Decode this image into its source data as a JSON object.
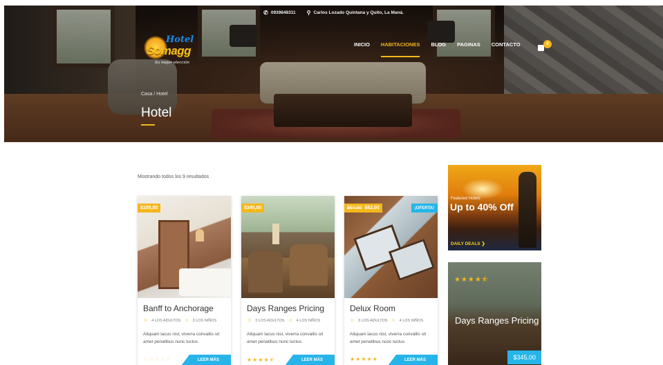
{
  "topbar": {
    "phone": "0939848311",
    "address": "Carlos Lozado Quintana y Quito, La Maná."
  },
  "logo": {
    "hotel": "Hotel",
    "brand": "Somagg",
    "tagline": "Su mejor elección"
  },
  "nav": {
    "items": [
      "INICIO",
      "HABITACIONES",
      "BLOG",
      "PAGINAS",
      "CONTACTO"
    ],
    "active": "HABITACIONES",
    "cart_count": "0"
  },
  "hero": {
    "breadcrumb": "Casa / Hotel",
    "title": "Hotel"
  },
  "results": {
    "count_text": "Mostrando todos los 9 resultados"
  },
  "rooms": [
    {
      "price": "$105,00",
      "title": "Banff to Anchorage",
      "adults": "4 LOS ADULTOS",
      "kids": "3 LOS NIÑOS",
      "desc": "Aliquam lacus nisl, viverra convallis sit amet penatibus nunc luctus",
      "rating": 0,
      "more": "LEER MÁS"
    },
    {
      "price": "$345,00",
      "title": "Days Ranges Pricing",
      "adults": "3 LOS ADULTOS",
      "kids": "4 LOS NIÑOS",
      "desc": "Aliquam lacus nisl, viverra convallis sit amet penatibus nunc luctus",
      "rating": 4.5,
      "more": "LEER MÁS"
    },
    {
      "old_price": "$67,00",
      "price": "$62,00",
      "offer": "¡OFERTA!",
      "title": "Delux Room",
      "adults": "3 LOS ADULTOS",
      "kids": "4 LOS NIÑOS",
      "desc": "Aliquam lacus nisl, viverra convallis sit amet penatibus nunc luctus",
      "rating": 5,
      "more": "LEER MÁS"
    }
  ],
  "sidebar": {
    "ad": {
      "small": "Featured Hotels",
      "big": "Up to 40% Off",
      "deals": "DAILY DEALS ❯"
    },
    "featured": {
      "rating": 4.5,
      "title": "Days Ranges Pricing",
      "price": "$345,00"
    }
  },
  "colors": {
    "accent": "#f4b71e",
    "blue": "#27b5e9"
  }
}
